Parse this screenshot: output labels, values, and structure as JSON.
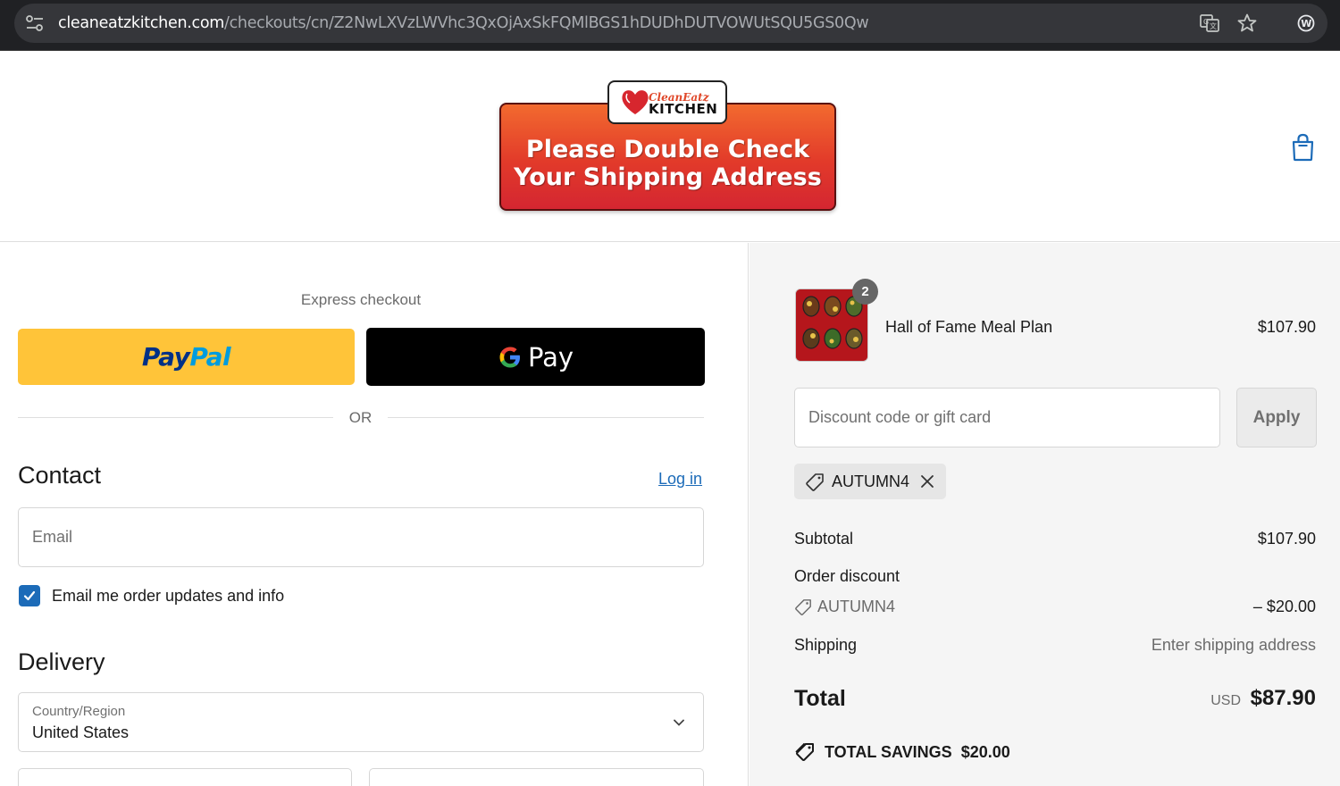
{
  "browser": {
    "url_host": "cleaneatzkitchen.com",
    "url_path": "/checkouts/cn/Z2NwLXVzLWVhc3QxOjAxSkFQMlBGS1hDUDhDUTVOWUtSQU5GS0Qw"
  },
  "header": {
    "logo_top": "CleanEatz",
    "logo_bottom": "KITCHEN",
    "banner_line1": "Please Double Check",
    "banner_line2": "Your Shipping Address"
  },
  "express": {
    "label": "Express checkout",
    "paypal_part1": "Pay",
    "paypal_part2": "Pal",
    "gpay_label": "Pay",
    "or_label": "OR"
  },
  "contact": {
    "title": "Contact",
    "login_label": "Log in",
    "email_placeholder": "Email",
    "updates_label": "Email me order updates and info",
    "updates_checked": true
  },
  "delivery": {
    "title": "Delivery",
    "country_label": "Country/Region",
    "country_value": "United States"
  },
  "summary": {
    "item": {
      "name": "Hall of Fame Meal Plan",
      "price": "$107.90",
      "quantity": "2"
    },
    "discount_placeholder": "Discount code or gift card",
    "apply_label": "Apply",
    "applied_code": "AUTUMN4",
    "subtotal_label": "Subtotal",
    "subtotal_value": "$107.90",
    "order_discount_label": "Order discount",
    "order_discount_code": "AUTUMN4",
    "order_discount_value": "– $20.00",
    "shipping_label": "Shipping",
    "shipping_value": "Enter shipping address",
    "total_label": "Total",
    "total_currency": "USD",
    "total_value": "$87.90",
    "savings_label": "TOTAL SAVINGS",
    "savings_value": "$20.00"
  },
  "colors": {
    "link": "#1c6bb8",
    "paypal_yellow": "#ffc439",
    "banner_red": "#e23a2a"
  }
}
